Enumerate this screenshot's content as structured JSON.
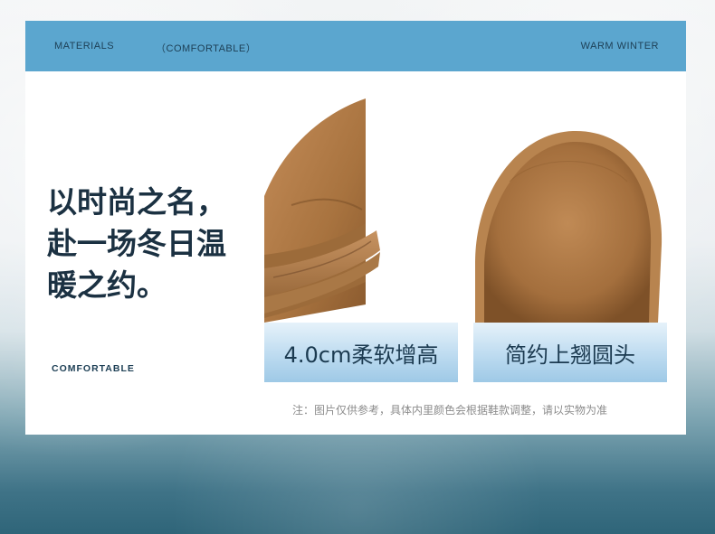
{
  "header": {
    "left": "MATERIALS",
    "middle": "（COMFORTABLE）",
    "right": "WARM WINTER"
  },
  "headline": {
    "line1": "以时尚之名，",
    "line2": "赴一场冬日温",
    "line3": "暖之约。"
  },
  "tagline": "COMFORTABLE",
  "features": [
    {
      "label": "4.0cm柔软增高"
    },
    {
      "label": "简约上翘圆头"
    }
  ],
  "note": "注：图片仅供参考，具体内里颜色会根据鞋款调整，请以实物为准",
  "colors": {
    "header_bar": "#5ba6cf",
    "suede": "#b07a48",
    "sole": "#b8844f",
    "text_dark": "#1b3142"
  }
}
